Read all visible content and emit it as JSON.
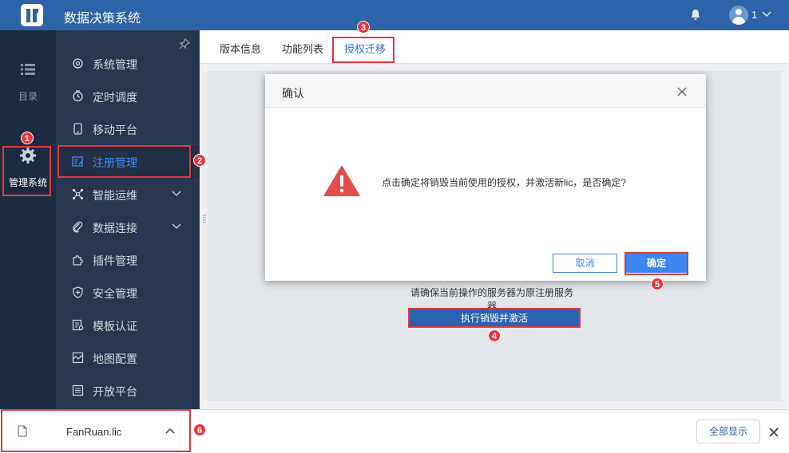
{
  "app": {
    "title": "数据决策系统",
    "user_name": "1"
  },
  "rail": [
    {
      "label": "目录",
      "icon": "list-icon"
    },
    {
      "label": "管理系统",
      "icon": "gear-icon"
    }
  ],
  "subnav": {
    "items": [
      {
        "label": "系统管理",
        "icon": "gear-icon"
      },
      {
        "label": "定时调度",
        "icon": "timer-icon"
      },
      {
        "label": "移动平台",
        "icon": "mobile-icon"
      },
      {
        "label": "注册管理",
        "icon": "register-icon"
      },
      {
        "label": "智能运维",
        "icon": "nodes-icon"
      },
      {
        "label": "数据连接",
        "icon": "link-icon"
      },
      {
        "label": "插件管理",
        "icon": "puzzle-icon"
      },
      {
        "label": "安全管理",
        "icon": "shield-icon"
      },
      {
        "label": "模板认证",
        "icon": "template-icon"
      },
      {
        "label": "地图配置",
        "icon": "map-icon"
      },
      {
        "label": "开放平台",
        "icon": "platform-icon"
      }
    ]
  },
  "tabs": [
    {
      "label": "版本信息"
    },
    {
      "label": "功能列表"
    },
    {
      "label": "授权迁移"
    }
  ],
  "panel": {
    "hint": "请确保当前操作的服务器为原注册服务器",
    "exec_label": "执行销毁并激活"
  },
  "dialog": {
    "title": "确认",
    "message": "点击确定将销毁当前使用的授权，并激活新lic，是否确定?",
    "cancel_label": "取消",
    "ok_label": "确定"
  },
  "download": {
    "file_name": "FanRuan.lic",
    "show_all_label": "全部显示"
  },
  "annotations": [
    "1",
    "2",
    "3",
    "4",
    "5",
    "6"
  ],
  "colors": {
    "topbar": "#2d63a8",
    "rail": "#1c2a41",
    "subnav": "#27374f",
    "accent": "#3e86ef",
    "annotation": "#e2393f",
    "warning": "#e54d4d"
  }
}
